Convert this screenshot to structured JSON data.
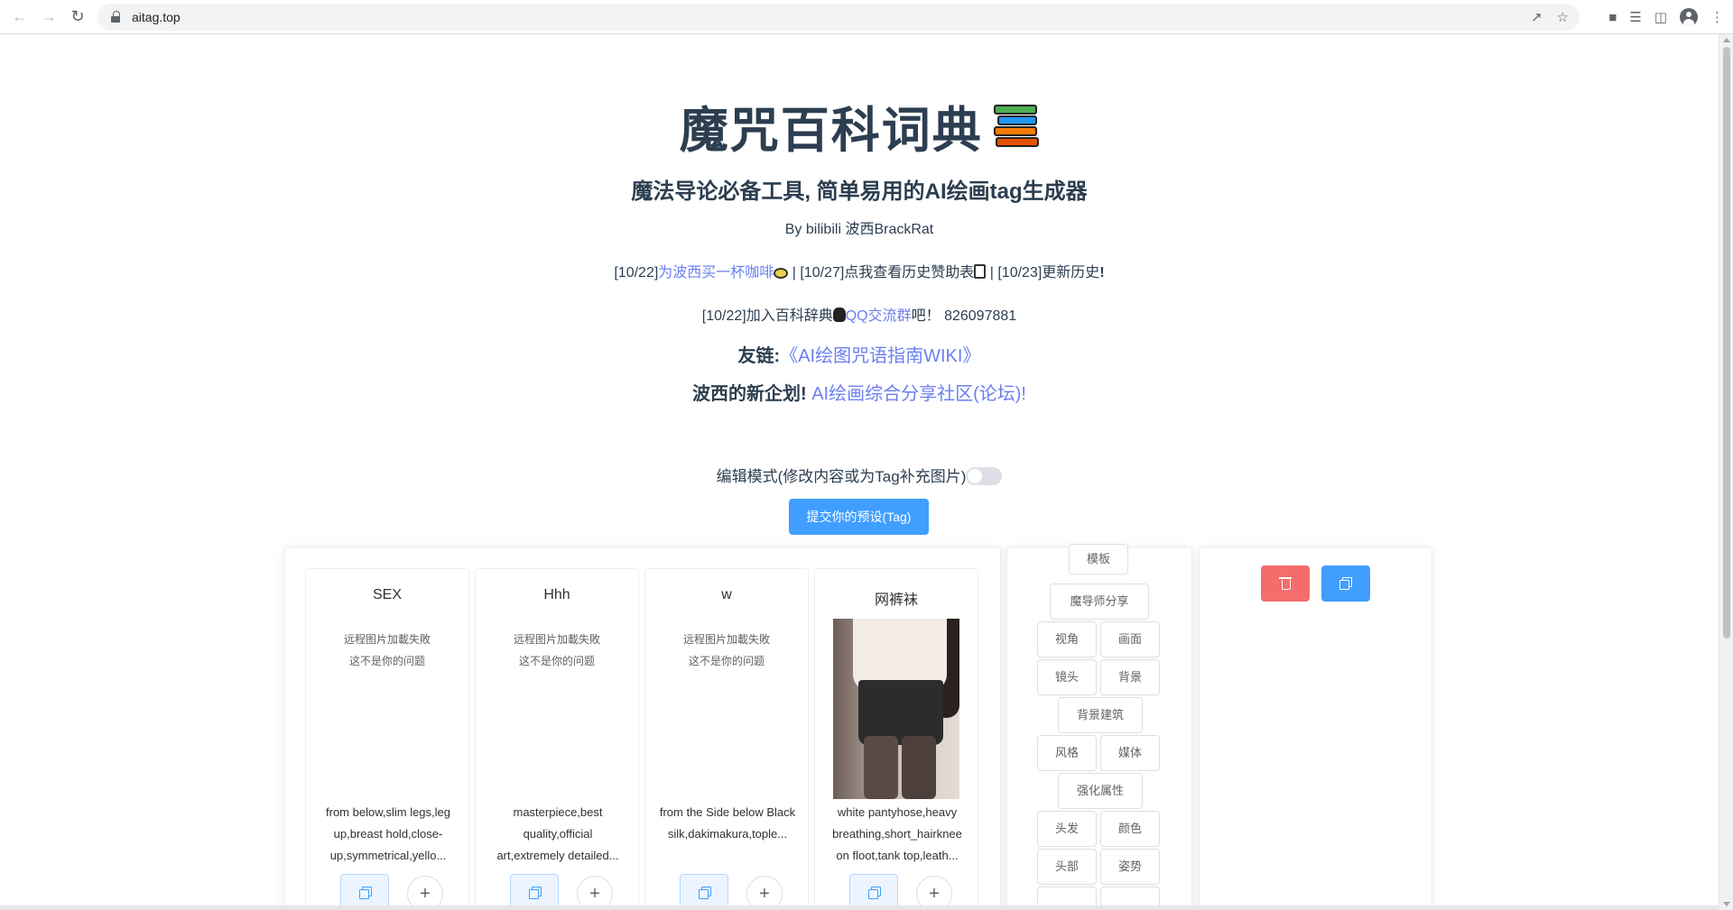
{
  "browser": {
    "url": "aitag.top"
  },
  "header": {
    "title": "魔咒百科词典",
    "subtitle": "魔法导论必备工具, 简单易用的AI绘画tag生成器",
    "author": "By bilibili 波西BrackRat",
    "news": {
      "part1_prefix": "[10/22]",
      "part1_link": "为波西买一杯咖啡",
      "sep1": " | [10/27]",
      "part2_text": "点我查看历史赞助表",
      "sep2": " | [10/23]",
      "part3_text": "更新历史"
    },
    "news2": {
      "prefix": "[10/22]加入百科辞典",
      "link": "QQ交流群",
      "suffix": "吧！ 826097881"
    },
    "friend_link": {
      "label": "友链:",
      "link": "《AI绘图咒语指南WIKI》"
    },
    "new_plan": {
      "label": "波西的新企划!",
      "link": "AI绘画综合分享社区(论坛)!"
    },
    "edit_mode_label": "编辑模式(修改内容或为Tag补充图片)",
    "submit_button": "提交你的预设(Tag)"
  },
  "cards": [
    {
      "title": "SEX",
      "error_line1": "远程图片加載失敗",
      "error_line2": "这不是你的问题",
      "tags": "from below,slim legs,leg up,breast hold,close-up,symmetrical,yello..."
    },
    {
      "title": "Hhh",
      "error_line1": "远程图片加載失敗",
      "error_line2": "这不是你的问题",
      "tags": "masterpiece,best quality,official art,extremely detailed..."
    },
    {
      "title": "w",
      "error_line1": "远程图片加載失敗",
      "error_line2": "这不是你的问题",
      "tags": "from the Side below Black silk,dakimakura,tople..."
    },
    {
      "title": "网裤袜",
      "tags": "white pantyhose,heavy breathing,short_hairknee on floot,tank top,leath..."
    }
  ],
  "categories": [
    "模板",
    "魔导师分享",
    "视角",
    "画面",
    "镜头",
    "背景",
    "背景建筑",
    "风格",
    "媒体",
    "强化属性",
    "头发",
    "颜色",
    "头部",
    "姿势"
  ],
  "icons": {
    "back": "back-arrow-icon",
    "forward": "forward-arrow-icon",
    "reload": "reload-icon",
    "lock": "lock-icon",
    "copy": "copy-icon",
    "add": "plus-icon",
    "delete": "trash-icon"
  },
  "colors": {
    "primary": "#409eff",
    "danger": "#f56c6c",
    "link": "#6b7ff0",
    "title": "#2c3e50"
  }
}
